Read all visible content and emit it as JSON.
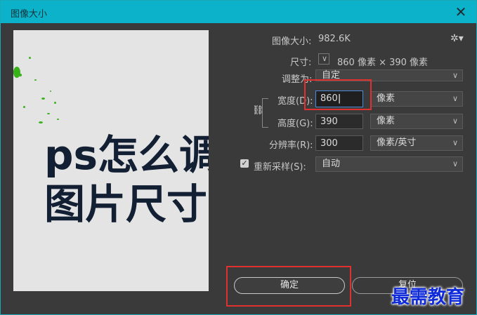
{
  "window": {
    "title": "图像大小"
  },
  "image_text": {
    "line1": "ps怎么调",
    "line2": "图片尺寸"
  },
  "info": {
    "size_label": "图像大小:",
    "size_value": "982.6K",
    "dimensions_label": "尺寸:",
    "dimensions_value": "860 像素 × 390 像素"
  },
  "fit_to": {
    "label": "调整为:",
    "value": "自定"
  },
  "width": {
    "label": "宽度(D):",
    "value": "860",
    "unit": "像素"
  },
  "height": {
    "label": "高度(G):",
    "value": "390",
    "unit": "像素"
  },
  "resolution": {
    "label": "分辨率(R):",
    "value": "300",
    "unit": "像素/英寸"
  },
  "resample": {
    "label": "重新采样(S):",
    "value": "自动",
    "checked": true
  },
  "buttons": {
    "ok": "确定",
    "cancel": "复位"
  },
  "watermark": "最需教育",
  "colors": {
    "titlebar": "#0cb2c9",
    "highlight": "#e03030",
    "watermark": "#0f2ad8"
  }
}
